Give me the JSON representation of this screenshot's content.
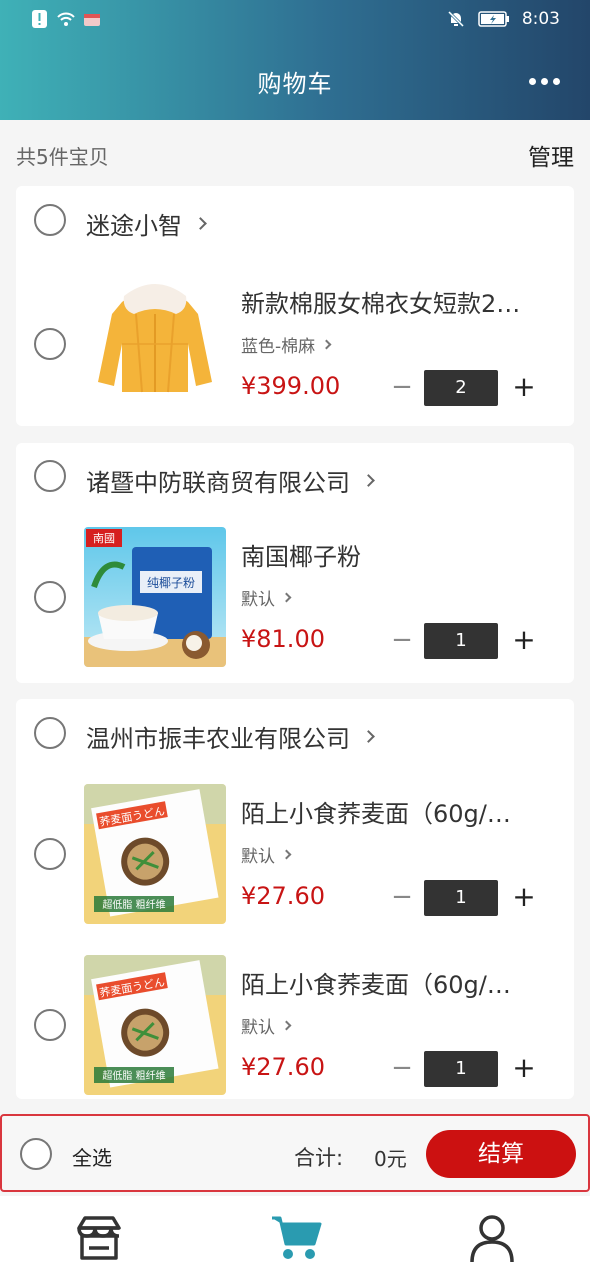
{
  "status_bar": {
    "time": "8:03"
  },
  "header": {
    "title": "购物车"
  },
  "summary": {
    "count_text": "共5件宝贝",
    "manage_label": "管理"
  },
  "stores": [
    {
      "name": "迷途小智",
      "items": [
        {
          "title": "新款棉服女棉衣女短款2…",
          "spec": "蓝色-棉麻",
          "price": "¥399.00",
          "qty": "2"
        }
      ]
    },
    {
      "name": "诸暨中防联商贸有限公司",
      "items": [
        {
          "title": "南国椰子粉",
          "spec": "默认",
          "price": "¥81.00",
          "qty": "1"
        }
      ]
    },
    {
      "name": "温州市振丰农业有限公司",
      "items": [
        {
          "title": "陌上小食荞麦面（60g/…",
          "spec": "默认",
          "price": "¥27.60",
          "qty": "1"
        },
        {
          "title": "陌上小食荞麦面（60g/…",
          "spec": "默认",
          "price": "¥27.60",
          "qty": "1"
        }
      ]
    }
  ],
  "thumbnails": {
    "coconut_brand": "南國",
    "coconut_label": "纯椰子粉",
    "noodle_label": "荞麦面うどん",
    "noodle_tag": "超低脂 粗纤维"
  },
  "checkout": {
    "select_all_label": "全选",
    "total_label": "合计:",
    "total_value": "0元",
    "pay_label": "结算"
  },
  "tabs": [
    {
      "icon": "store-icon",
      "active": false
    },
    {
      "icon": "cart-icon",
      "active": true
    },
    {
      "icon": "user-icon",
      "active": false
    }
  ],
  "colors": {
    "header_start": "#3fb1b7",
    "header_end": "#23466a",
    "price": "#c81414",
    "pay_button": "#cc1111",
    "active_tab": "#2a9bb0"
  }
}
